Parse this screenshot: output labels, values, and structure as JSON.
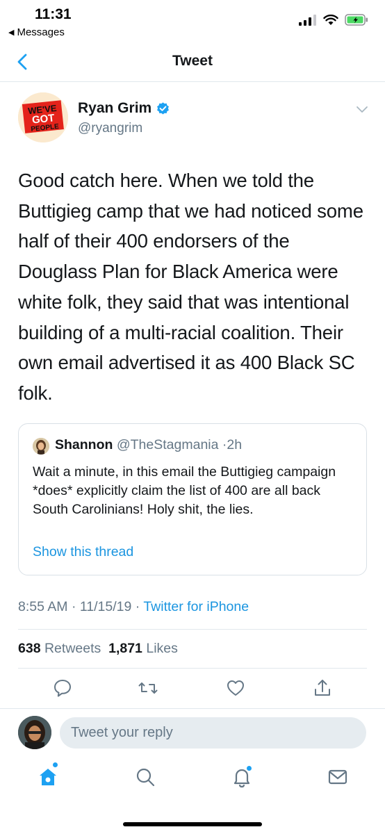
{
  "status_bar": {
    "time": "11:31",
    "back_app": "Messages"
  },
  "nav": {
    "title": "Tweet"
  },
  "tweet": {
    "author_name": "Ryan Grim",
    "author_handle": "@ryangrim",
    "verified": true,
    "avatar_text": [
      "WE'VE",
      "GOT",
      "PEOPLE"
    ],
    "text": "Good catch here. When we told the Buttigieg camp that we had noticed some half of their 400 endorsers of the Douglass Plan for Black America were white folk, they said that was intentional building of a multi-racial coalition. Their own email advertised it as 400 Black SC folk.",
    "time": "8:55 AM",
    "date": "11/15/19",
    "source": "Twitter for iPhone",
    "retweets_count": "638",
    "retweets_label": "Retweets",
    "likes_count": "1,871",
    "likes_label": "Likes"
  },
  "quote": {
    "name": "Shannon",
    "handle": "@TheStagmania",
    "age": "2h",
    "text": "Wait a minute, in this email the Buttigieg campaign *does* explicitly claim the list of 400 are all back South Carolinians! Holy shit, the lies.",
    "show_thread": "Show this thread"
  },
  "reply": {
    "placeholder": "Tweet your reply"
  },
  "colors": {
    "accent": "#1da1f2",
    "link": "#1b95e0",
    "secondary_text": "#657786",
    "divider": "#e1e8ed"
  },
  "icons": {
    "actions": [
      "reply-icon",
      "retweet-icon",
      "like-icon",
      "share-icon"
    ],
    "tabs": [
      "home-icon",
      "search-icon",
      "notifications-icon",
      "messages-icon"
    ]
  }
}
